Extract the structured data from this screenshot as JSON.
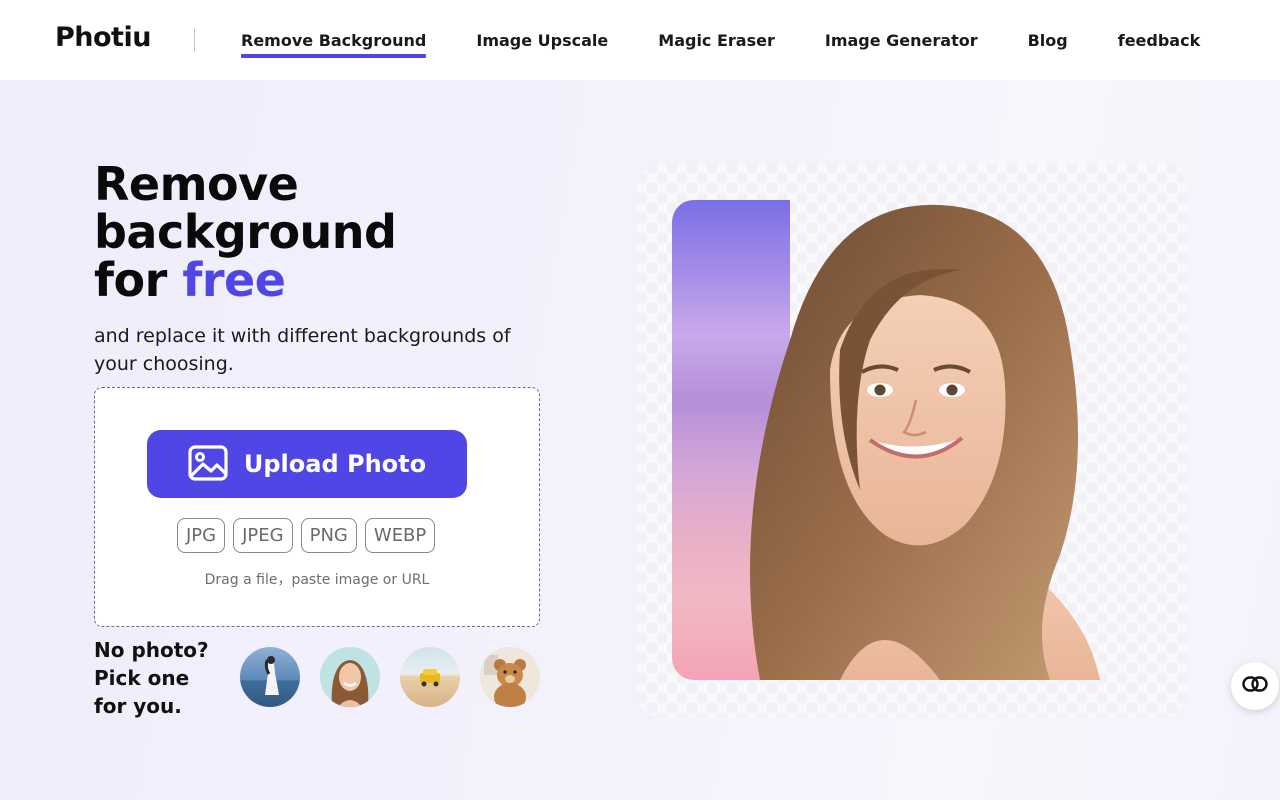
{
  "header": {
    "logo": "Photiu",
    "nav": [
      {
        "label": "Remove Background",
        "active": true
      },
      {
        "label": "Image Upscale",
        "active": false
      },
      {
        "label": "Magic Eraser",
        "active": false
      },
      {
        "label": "Image Generator",
        "active": false
      },
      {
        "label": "Blog",
        "active": false
      },
      {
        "label": "feedback",
        "active": false
      }
    ]
  },
  "hero": {
    "title_line1": "Remove",
    "title_line2": "background",
    "title_line3_prefix": "for",
    "title_accent": "free",
    "subtitle": "and replace it with different backgrounds of your choosing."
  },
  "upload": {
    "button_label": "Upload Photo",
    "button_icon": "image-icon",
    "formats": [
      "JPG",
      "JPEG",
      "PNG",
      "WEBP"
    ],
    "hint": "Drag a file，paste image or URL"
  },
  "samples": {
    "prompt_line1": "No photo?",
    "prompt_line2": "Pick one",
    "prompt_line3": "for you.",
    "items": [
      "woman-on-beach",
      "smiling-woman",
      "yellow-car-on-sand",
      "teddy-bear"
    ]
  },
  "fab_icon": "infinity-icon",
  "colors": {
    "accent": "#4f46e5",
    "page_bg": "#f1f0fb",
    "header_bg": "#ffffff"
  }
}
